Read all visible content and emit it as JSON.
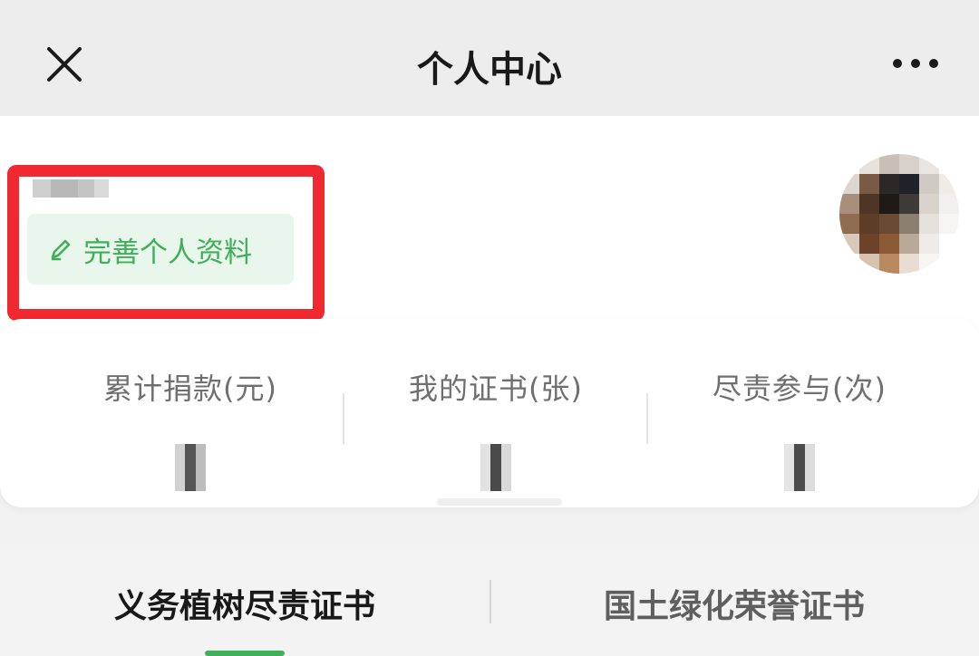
{
  "nav": {
    "title": "个人中心",
    "close_icon": "close-icon",
    "more_icon": "more-icon"
  },
  "profile": {
    "edit_button_label": "完善个人资料",
    "edit_icon": "pencil-icon",
    "avatar_icon": "avatar"
  },
  "stats": [
    {
      "label": "累计捐款(元)"
    },
    {
      "label": "我的证书(张)"
    },
    {
      "label": "尽责参与(次)"
    }
  ],
  "tabs": [
    {
      "label": "义务植树尽责证书",
      "active": true
    },
    {
      "label": "国土绿化荣誉证书",
      "active": false
    }
  ],
  "colors": {
    "accent_green": "#3fb05a",
    "highlight_red": "#f0282f"
  }
}
